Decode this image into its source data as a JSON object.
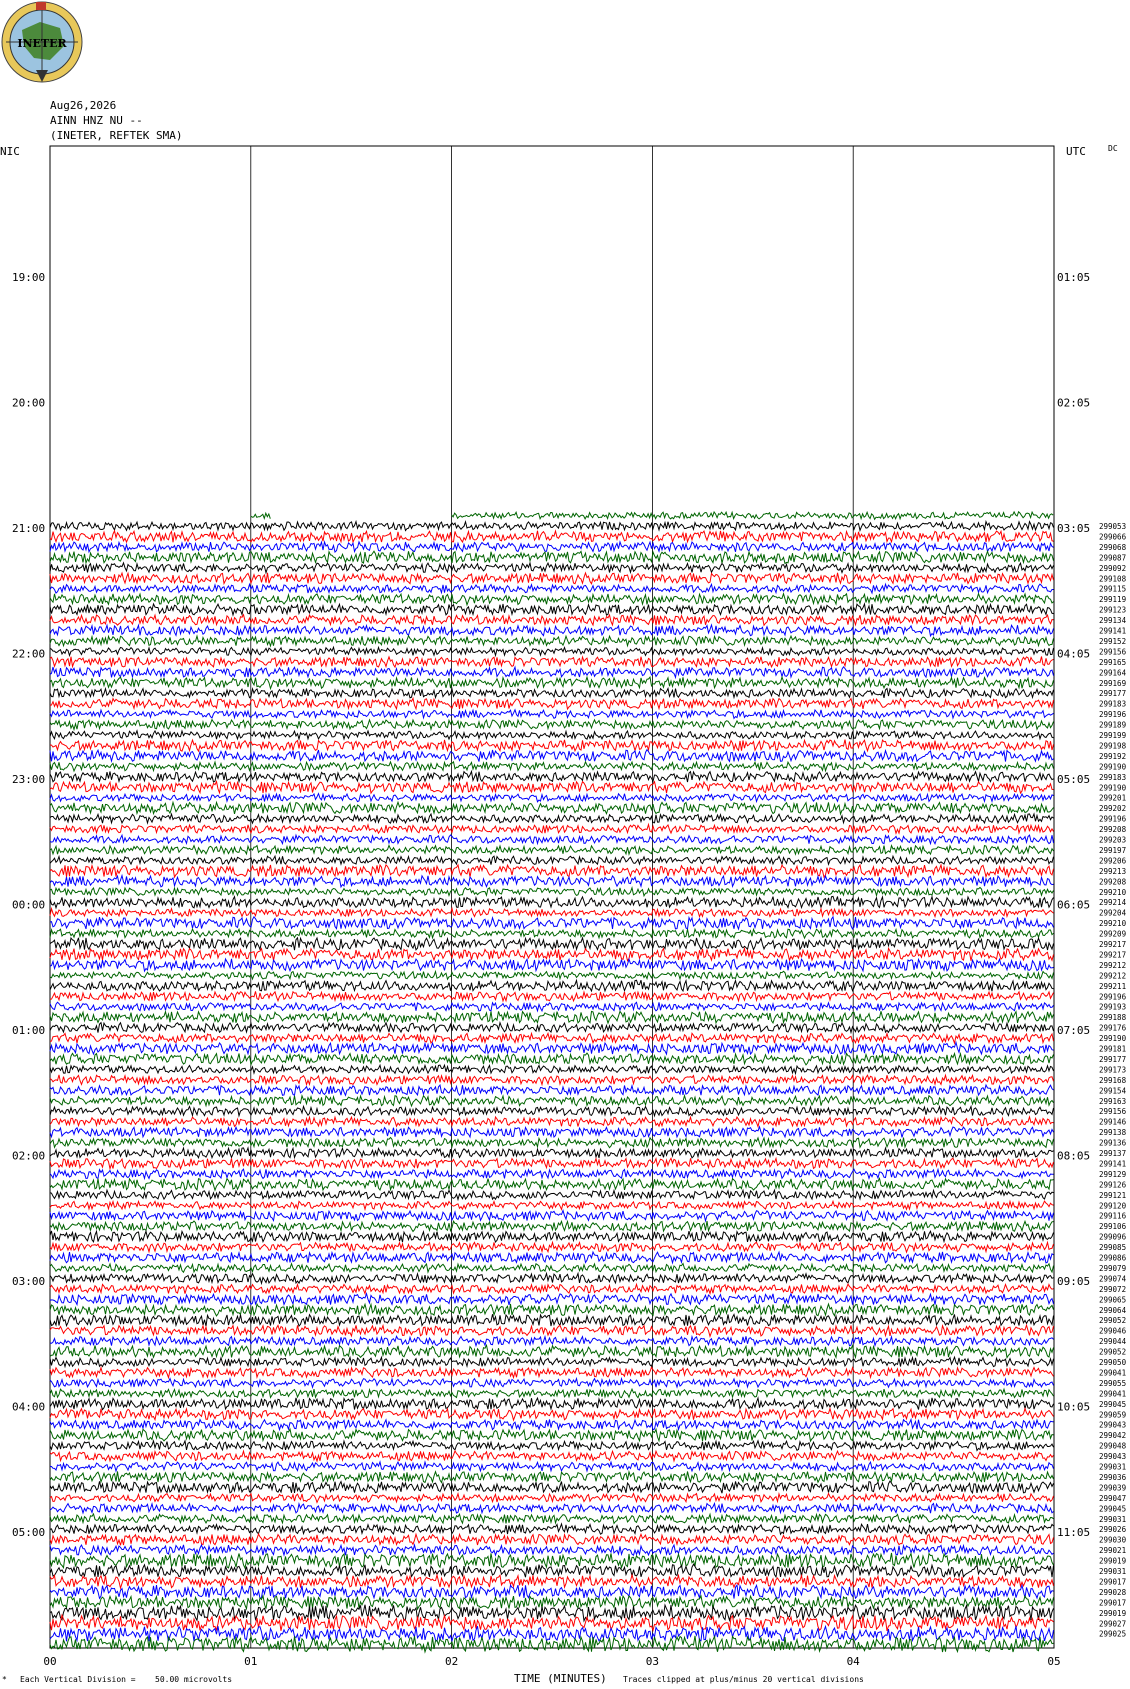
{
  "logo": {
    "text": "INETER"
  },
  "header": {
    "date": "Aug26,2026",
    "station": "AINN HNZ NU --",
    "network": "(INETER, REFTEK SMA)"
  },
  "left_zone": "NIC",
  "right_zone": "UTC",
  "dc_label": "DC",
  "footer": {
    "division": "Each Vertical Division =",
    "scale": "50.00 microvolts",
    "xlabel": "TIME (MINUTES)",
    "clip_note": "Traces clipped at plus/minus 20 vertical divisions"
  },
  "colors": {
    "cycle": [
      "#000000",
      "#ff0000",
      "#0000ff",
      "#006400"
    ]
  },
  "chart_data": {
    "type": "line",
    "xlabel": "TIME (MINUTES)",
    "x_ticks": [
      "00",
      "01",
      "02",
      "03",
      "04",
      "05"
    ],
    "xlim": [
      0,
      5
    ],
    "left_time_labels": [
      "19:00",
      "20:00",
      "21:00",
      "22:00",
      "23:00",
      "00:00",
      "01:00",
      "02:00",
      "03:00",
      "04:00",
      "05:00"
    ],
    "right_time_labels": [
      "01:05",
      "02:05",
      "03:05",
      "04:05",
      "05:05",
      "06:05",
      "07:05",
      "08:05",
      "09:05",
      "10:05",
      "11:05"
    ],
    "first_partial_trace": {
      "segments_minutes": [
        [
          1.0,
          1.1
        ],
        [
          2.0,
          5.0
        ]
      ]
    },
    "trace_count": 108,
    "trace_values": [
      "299053",
      "299066",
      "299068",
      "299087",
      "299092",
      "299108",
      "299115",
      "299119",
      "299123",
      "299134",
      "299141",
      "299152",
      "299156",
      "299165",
      "299164",
      "299169",
      "299177",
      "299183",
      "299196",
      "299189",
      "299199",
      "299198",
      "299192",
      "299190",
      "299183",
      "299190",
      "299201",
      "299202",
      "299196",
      "299208",
      "299203",
      "299197",
      "299206",
      "299213",
      "299208",
      "299210",
      "299214",
      "299204",
      "299210",
      "299209",
      "299217",
      "299217",
      "299212",
      "299212",
      "299211",
      "299196",
      "299193",
      "299188",
      "299176",
      "299190",
      "299181",
      "299177",
      "299173",
      "299168",
      "299154",
      "299163",
      "299156",
      "299146",
      "299138",
      "299136",
      "299137",
      "299141",
      "299129",
      "299126",
      "299121",
      "299120",
      "299116",
      "299106",
      "299096",
      "299085",
      "299086",
      "299079",
      "299074",
      "299072",
      "299065",
      "299064",
      "299052",
      "299046",
      "299044",
      "299052",
      "299050",
      "299041",
      "299055",
      "299041",
      "299045",
      "299059",
      "299043",
      "299042",
      "299048",
      "299043",
      "299031",
      "299036",
      "299039",
      "299047",
      "299045",
      "299031",
      "299026",
      "299030",
      "299021",
      "299019",
      "299031",
      "299017",
      "299028",
      "299017",
      "299019",
      "299027",
      "299025"
    ]
  }
}
